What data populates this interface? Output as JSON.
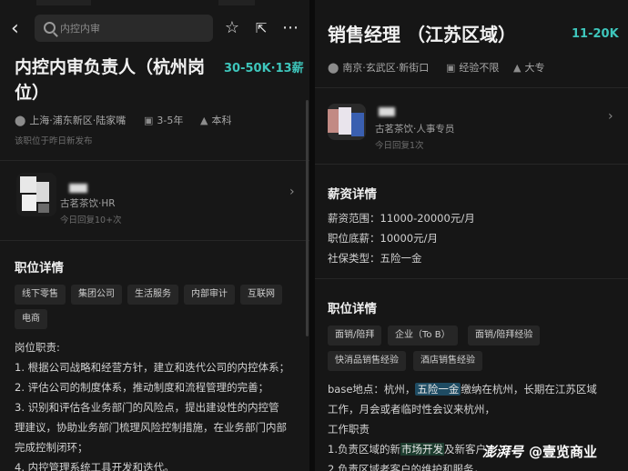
{
  "left": {
    "search_placeholder": "内控内审",
    "icons": [
      "back-icon",
      "search-icon",
      "star-icon",
      "share-icon",
      "more-icon",
      "location-icon",
      "briefcase-icon",
      "graduation-icon",
      "chevron-right-icon"
    ],
    "job_title": "内控内审负责人（杭州岗位）",
    "salary": "30-50K·13薪",
    "location": "上海·浦东新区·陆家嘴",
    "experience": "3-5年",
    "education": "本科",
    "posted": "该职位于昨日新发布",
    "recruiter": {
      "company_role": "古茗茶饮·HR",
      "reply": "今日回复10+次"
    },
    "section_title": "职位详情",
    "tags": [
      "线下零售",
      "集团公司",
      "生活服务",
      "内部审计",
      "互联网",
      "电商"
    ],
    "body": [
      "岗位职责:",
      "1. 根据公司战略和经营方针，建立和迭代公司的内控体系；",
      "2. 评估公司的制度体系，推动制度和流程管理的完善；",
      "3. 识别和评估各业务部门的风险点，提出建设性的内控管",
      "理建议，协助业务部门梳理风险控制措施，在业务部门内部",
      "完成控制闭环；",
      "4. 内控管理系统工具开发和迭代。"
    ]
  },
  "right": {
    "job_title": "销售经理 （江苏区域）",
    "salary": "11-20K",
    "location": "南京·玄武区·新街口",
    "experience": "经验不限",
    "education": "大专",
    "recruiter": {
      "company_role": "古茗茶饮·人事专员",
      "reply": "今日回复1次"
    },
    "salary_section_title": "薪资详情",
    "salary_lines": [
      "薪资范围：11000-20000元/月",
      "职位底薪：10000元/月",
      "社保类型：五险一金"
    ],
    "section_title": "职位详情",
    "tags": [
      "面销/陪拜",
      "企业（To B）",
      "面销/陪拜经验",
      "快消品销售经验",
      "酒店销售经验"
    ],
    "body": {
      "line1_a": "base地点：杭州，",
      "line1_hl": "五险一金",
      "line1_b": "缴纳在杭州，长期在江苏区域",
      "line2": "工作，月会或者临时性会议来杭州，",
      "line3": "工作职责",
      "line4_a": "1.负责区域的新",
      "line4_hl": "市场开发",
      "line4_b": "及新客户",
      "line5": "2.负责区域老客户的维护和服务，"
    }
  },
  "watermark": {
    "brand": "澎湃号",
    "account": "@壹览商业"
  }
}
